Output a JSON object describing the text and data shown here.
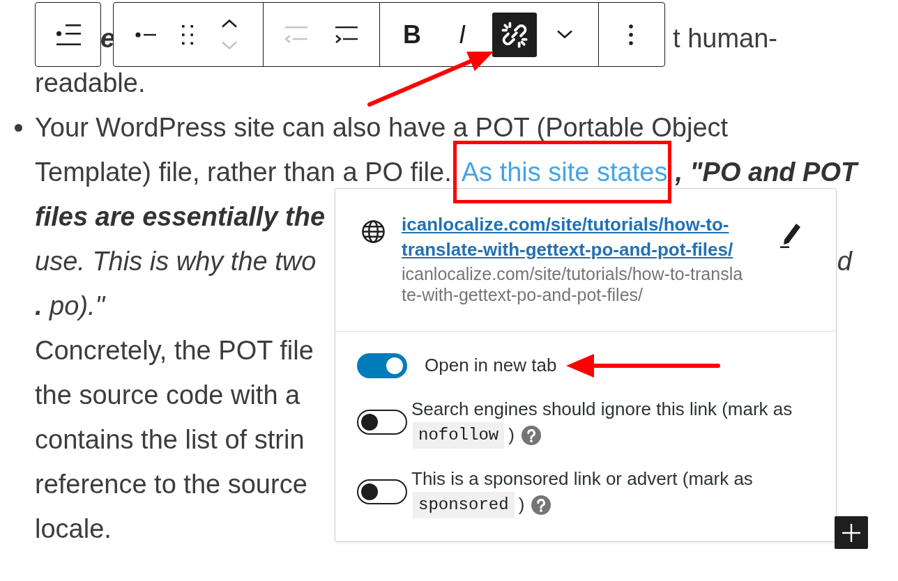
{
  "toolbar": {
    "block_button": {
      "kind": "list"
    },
    "groups": [
      [
        {
          "kind": "bullet",
          "disabled": false,
          "pressed": false
        },
        {
          "kind": "handle",
          "disabled": false,
          "pressed": false
        },
        {
          "kind": "up",
          "disabled": false,
          "pressed": false
        },
        {
          "kind": "down",
          "disabled": true,
          "pressed": false
        }
      ],
      [
        {
          "kind": "outdent",
          "disabled": true,
          "pressed": false
        },
        {
          "kind": "indent",
          "disabled": false,
          "pressed": false
        }
      ],
      [
        {
          "kind": "bold",
          "label": "B",
          "disabled": false,
          "pressed": false
        },
        {
          "kind": "italic",
          "label": "I",
          "disabled": false,
          "pressed": false
        },
        {
          "kind": "link",
          "disabled": false,
          "pressed": true
        },
        {
          "kind": "chevron",
          "disabled": false,
          "pressed": false
        }
      ],
      [
        {
          "kind": "options",
          "disabled": false,
          "pressed": false
        }
      ]
    ]
  },
  "paragraph_above": {
    "line_1": {
      "left": "e",
      "right": "t human-"
    },
    "line_2": "readable."
  },
  "list_item": {
    "lines": [
      {
        "segments": [
          {
            "kind": "plain",
            "text": "Your WordPress site can also have a POT (Portable Object"
          }
        ]
      },
      {
        "segments": [
          {
            "kind": "plain",
            "text": "Template) file, rather than a PO file. "
          },
          {
            "kind": "link",
            "text": "As this site states"
          },
          {
            "kind": "strong",
            "text": ", \"PO and POT"
          }
        ]
      },
      {
        "segments": [
          {
            "kind": "strong",
            "text": "files are essentially the"
          }
        ]
      },
      {
        "segments": [
          {
            "kind": "italic",
            "text": "use. This is why the two"
          }
        ],
        "right": {
          "kind": "italic",
          "text": "d"
        }
      },
      {
        "segments": [
          {
            "kind": "italic",
            "text": "**.** po).\""
          }
        ]
      },
      {
        "segments": [
          {
            "kind": "plain",
            "text": "Concretely, the POT file"
          }
        ]
      },
      {
        "segments": [
          {
            "kind": "plain",
            "text": "the source code with a"
          }
        ]
      },
      {
        "segments": [
          {
            "kind": "plain",
            "text": "contains the list of strin"
          }
        ]
      },
      {
        "segments": [
          {
            "kind": "plain",
            "text": "reference to the source"
          }
        ]
      },
      {
        "segments": [
          {
            "kind": "plain",
            "text": "locale."
          }
        ]
      }
    ]
  },
  "link_popup": {
    "link": "icanlocalize.com/site/tutorials/how-to-translate-with-gettext-po-and-pot-files/",
    "url": "icanlocalize.com/site/tutorials/how-to-translate-with-gettext-po-and-pot-files/",
    "settings": [
      {
        "label": "Open in new tab",
        "on": true,
        "help": false
      },
      {
        "label": "Search engines should ignore this link (mark as",
        "code": "nofollow",
        "after": ")",
        "on": false,
        "help": true
      },
      {
        "label": "This is a sponsored link or advert (mark as",
        "code": "sponsored",
        "after": ")",
        "on": false,
        "help": true
      }
    ]
  }
}
